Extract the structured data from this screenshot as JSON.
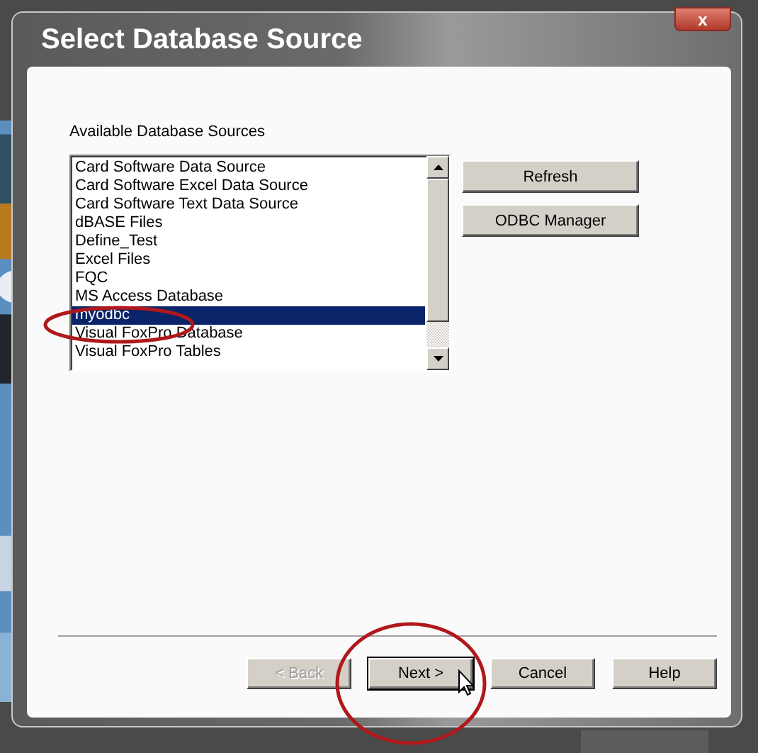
{
  "window": {
    "title": "Select Database Source",
    "close_label": "x"
  },
  "sources": {
    "label": "Available Database Sources",
    "items": [
      {
        "label": "Card Software Data Source",
        "selected": false
      },
      {
        "label": "Card Software Excel Data Source",
        "selected": false
      },
      {
        "label": "Card Software Text Data Source",
        "selected": false
      },
      {
        "label": "dBASE Files",
        "selected": false
      },
      {
        "label": "Define_Test",
        "selected": false
      },
      {
        "label": "Excel Files",
        "selected": false
      },
      {
        "label": "FQC",
        "selected": false
      },
      {
        "label": "MS Access Database",
        "selected": false
      },
      {
        "label": "myodbc",
        "selected": true
      },
      {
        "label": "Visual FoxPro Database",
        "selected": false
      },
      {
        "label": "Visual FoxPro Tables",
        "selected": false
      }
    ]
  },
  "side_buttons": [
    {
      "label": "Refresh"
    },
    {
      "label": "ODBC Manager"
    }
  ],
  "footer_buttons": [
    {
      "label": "< Back",
      "disabled": true,
      "default": false
    },
    {
      "label": "Next >",
      "disabled": false,
      "default": true
    },
    {
      "label": "Cancel",
      "disabled": false,
      "default": false
    },
    {
      "label": "Help",
      "disabled": false,
      "default": false
    }
  ]
}
